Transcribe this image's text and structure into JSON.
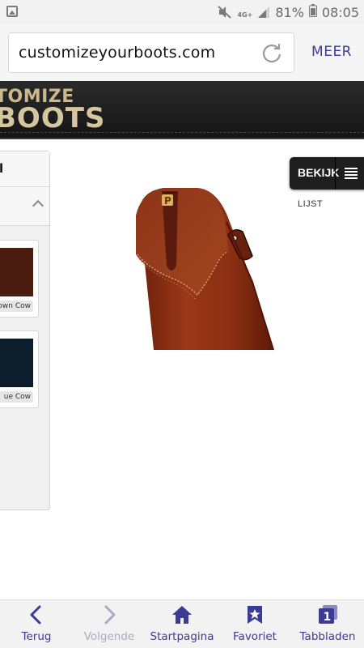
{
  "status_bar": {
    "network": "4G+",
    "battery": "81%",
    "time": "08:05"
  },
  "browser": {
    "url": "customizeyourboots.com",
    "more_label": "MEER"
  },
  "site": {
    "logo_line1": "TOMIZE",
    "logo_line2": "BOOTS"
  },
  "sidebar": {
    "title": "l",
    "swatches": [
      {
        "label": "own Cow",
        "color": "#4a1c10"
      },
      {
        "label": "ue Cow",
        "color": "#0c1e2c"
      }
    ]
  },
  "view_toggle": {
    "label": "BEKIJK",
    "sub_label": "LIJST"
  },
  "nav": {
    "back": "Terug",
    "forward": "Volgende",
    "home": "Startpagina",
    "favorites": "Favoriet",
    "tabs": "Tabbladen",
    "tab_count": "1"
  },
  "colors": {
    "nav_accent": "#3b3b96",
    "header_bg": "#1c1c1c",
    "boot_leather": "#8a2e14"
  }
}
